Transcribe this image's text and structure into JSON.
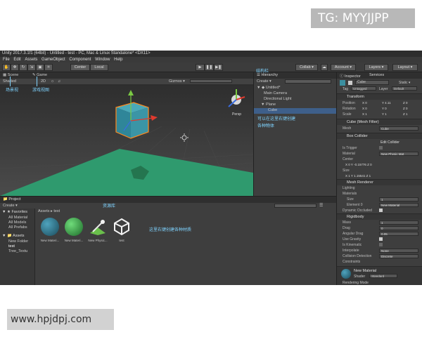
{
  "watermark_top": "TG: MYYJJPP",
  "watermark_bottom": "www.hpjdpj.com",
  "title_bar": "Unity 2017.3.1f1 (64bit) - Untitled - test - PC, Mac & Linux Standalone* <DX11>",
  "menu": [
    "File",
    "Edit",
    "Assets",
    "GameObject",
    "Component",
    "Window",
    "Help"
  ],
  "toolbar": {
    "pivot_center": "Center",
    "space": "Local",
    "collab": "Collab ▾",
    "account": "Account ▾",
    "layers": "Layers ▾",
    "layout": "Layout ▾"
  },
  "scene": {
    "tab_scene": "Scene",
    "tab_game": "Game",
    "shading": "Shaded",
    "mode_2d": "2D",
    "gizmos": "Gizmos ▾",
    "persp": "Persp"
  },
  "hierarchy": {
    "title": "Hierarchy",
    "create": "Create ▾",
    "scene_name": "Untitled*",
    "items": [
      "Main Camera",
      "Directional Light",
      "Plane",
      "Cube"
    ]
  },
  "inspector": {
    "tab_inspector": "Inspector",
    "tab_services": "Services",
    "object_name": "Cube",
    "static": "Static ▾",
    "tag_label": "Tag",
    "tag_value": "Untagged",
    "layer_label": "Layer",
    "layer_value": "Default",
    "transform": {
      "header": "Transform",
      "position": {
        "label": "Position",
        "x": "X 0",
        "y": "Y 4.11",
        "z": "Z 0"
      },
      "rotation": {
        "label": "Rotation",
        "x": "X 0",
        "y": "Y 0",
        "z": "Z 0"
      },
      "scale": {
        "label": "Scale",
        "x": "X 1",
        "y": "Y 1",
        "z": "Z 1"
      }
    },
    "mesh_filter": {
      "header": "Cube (Mesh Filter)",
      "mesh_label": "Mesh",
      "mesh_value": "Cube"
    },
    "box_collider": {
      "header": "Box Collider",
      "edit": "Edit Collider",
      "is_trigger": "Is Trigger",
      "material_label": "Material",
      "material_value": "New Physic Mat",
      "center_label": "Center",
      "center": "X 0   Y -0.15776  Z 0",
      "size_label": "Size",
      "size": "X 1   Y 1.15541  Z 1"
    },
    "mesh_renderer": {
      "header": "Mesh Renderer",
      "lighting": "Lighting",
      "materials": "Materials",
      "size_label": "Size",
      "size_value": "1",
      "element_label": "Element 0",
      "element_value": "New Material",
      "dyn_occluded": "Dynamic Occluded"
    },
    "rigidbody": {
      "header": "Rigidbody",
      "mass_label": "Mass",
      "mass": "1",
      "drag_label": "Drag",
      "drag": "0",
      "angular_drag_label": "Angular Drag",
      "angular_drag": "0.05",
      "use_gravity": "Use Gravity",
      "is_kinematic": "Is Kinematic",
      "interpolate_label": "Interpolate",
      "interpolate": "None",
      "collision_label": "Collision Detection",
      "collision": "Discrete",
      "constraints": "Constraints"
    },
    "material": {
      "name": "New Material",
      "shader_label": "Shader",
      "shader": "Standard",
      "rendering_mode": "Rendering Mode"
    }
  },
  "project": {
    "title": "Project",
    "create": "Create ▾",
    "breadcrumb": "Assets ▸ test",
    "favorites": "Favorites",
    "fav_items": [
      "All Material",
      "All Models",
      "All Prefabs"
    ],
    "assets_root": "Assets",
    "asset_folders": [
      "New Folder",
      "test",
      "Tree_Textu"
    ],
    "assets": [
      {
        "name": "New Materi...",
        "color": "#2a6f86"
      },
      {
        "name": "New Materi...",
        "color": "#3a9a4a"
      },
      {
        "name": "New Physic...",
        "color": "#ffffff"
      },
      {
        "name": "test",
        "color": "#ffffff"
      }
    ]
  },
  "annotations": {
    "scene_view": "场景视",
    "game_view": "游戏视图",
    "hierarchy_label": "结构栏",
    "hierarchy_hint_1": "可以在这里右键创建",
    "hierarchy_hint_2": "各种物体",
    "asset_library": "资源库",
    "asset_hint": "这里右键创建各种材质"
  },
  "colors": {
    "cube": "#3b8fa0",
    "plane": "#2f9a6e",
    "annotation": "#7fd3ff",
    "selection": "#ff8a1e"
  }
}
